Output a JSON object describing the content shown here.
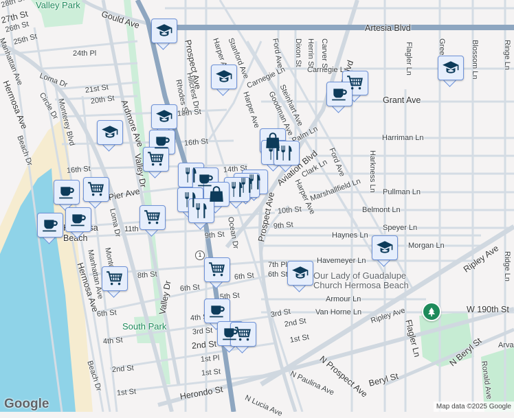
{
  "map": {
    "colors": {
      "land": "#f5f3f3",
      "water": "#8fd3e8",
      "beach": "#f6ecd0",
      "park": "#c6ecd3",
      "highway": "#8ea6c0",
      "road": "#d4dce4",
      "marker_fill": "#e6eefc",
      "marker_border": "#6e92d8",
      "icon": "#0d3b5a"
    },
    "route_shield": "1",
    "attribution": "Map data ©2025 Google",
    "logo": "Google",
    "poi_name_line1": "Our Lady of Guadalupe",
    "poi_name_line2": "Church Hermosa Beach",
    "places": [
      "Valley Park",
      "South Park",
      "Hermosa Beach"
    ],
    "streets": [
      "Gould Ave",
      "28th St",
      "27th St",
      "26th St",
      "25th St",
      "24th Pl",
      "Loma Dr",
      "21st St",
      "20th St",
      "18th St",
      "16th St",
      "16th St",
      "14th St",
      "Pier Ave",
      "Artesia Blvd",
      "Carnegie Ln",
      "Carnegie Ln",
      "Grant Ave",
      "Harriman Ln",
      "Pullman Ln",
      "Marshallfield Ln",
      "Clark Ln",
      "Palm Ln",
      "Belmont Ln",
      "Speyer Ln",
      "Haynes Ln",
      "Morgan Ln",
      "Havemeyer Ln",
      "Armour Ln",
      "Van Horne Ln",
      "Ripley Ave",
      "Ripley Ave",
      "W 190th St",
      "Arva",
      "N Beryl St",
      "Beryl St",
      "N Prospect Ave",
      "N Paulina Ave",
      "N Lucia Ave",
      "Herondo St",
      "1st St",
      "2nd St",
      "3rd St",
      "7th Pl",
      "6th St",
      "10th St",
      "9th St",
      "11th",
      "9th St",
      "8th St",
      "6th St",
      "6th St",
      "5th St",
      "4th St",
      "3rd St",
      "2nd St",
      "1st Pl",
      "1st St",
      "6th St",
      "4th St",
      "2nd St",
      "1st St",
      "Prospect Ave",
      "Harper Ave",
      "Stanford Ave",
      "Hillcrest Dr",
      "Rhodes St",
      "Harper Ave",
      "Ford Ave",
      "Dixon St",
      "Herrin St",
      "Carver St",
      "Steinhart Ave",
      "Goodman Ave",
      "Aviation Blvd",
      "Aviation Blvd",
      "Flagler Ln",
      "Green",
      "Blossom Ln",
      "Ringe Ln",
      "Harkness Ln",
      "Ford Ave",
      "Harper Ave",
      "Prospect Ave",
      "Ocean Dr",
      "Ardmore Ave",
      "Valley Dr",
      "Valley Dr",
      "Hermosa Ave",
      "Hermosa Ave",
      "Manhattan Ave",
      "Manhattan Ave",
      "Beach Dr",
      "Beach Dr",
      "Monterey Blvd",
      "Circle Dr",
      "Loma Dr",
      "Montere",
      "Flagler Ln",
      "Ronald Ave",
      "Ridge Ln",
      "2nd St"
    ],
    "markers": [
      {
        "type": "school",
        "icon": "graduation-cap-icon"
      },
      {
        "type": "school",
        "icon": "graduation-cap-icon"
      },
      {
        "type": "school",
        "icon": "graduation-cap-icon"
      },
      {
        "type": "school",
        "icon": "graduation-cap-icon"
      },
      {
        "type": "school",
        "icon": "graduation-cap-icon"
      },
      {
        "type": "school",
        "icon": "graduation-cap-icon"
      },
      {
        "type": "school",
        "icon": "graduation-cap-icon"
      },
      {
        "type": "cafe",
        "icon": "coffee-cup-icon"
      },
      {
        "type": "grocery",
        "icon": "shopping-cart-icon"
      },
      {
        "type": "restaurant",
        "icon": "fork-knife-icon"
      },
      {
        "type": "shopping",
        "icon": "shopping-bag-icon"
      },
      {
        "type": "park",
        "icon": "tree-icon"
      }
    ]
  }
}
